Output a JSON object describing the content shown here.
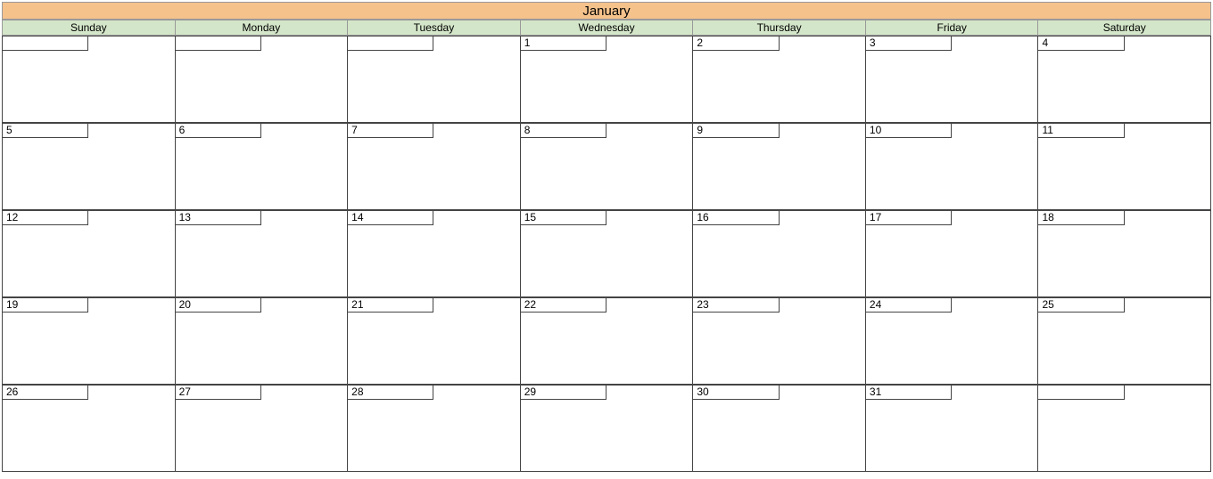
{
  "month": "January",
  "day_names": [
    "Sunday",
    "Monday",
    "Tuesday",
    "Wednesday",
    "Thursday",
    "Friday",
    "Saturday"
  ],
  "weeks": [
    [
      "",
      "",
      "",
      "1",
      "2",
      "3",
      "4"
    ],
    [
      "5",
      "6",
      "7",
      "8",
      "9",
      "10",
      "11"
    ],
    [
      "12",
      "13",
      "14",
      "15",
      "16",
      "17",
      "18"
    ],
    [
      "19",
      "20",
      "21",
      "22",
      "23",
      "24",
      "25"
    ],
    [
      "26",
      "27",
      "28",
      "29",
      "30",
      "31",
      ""
    ]
  ],
  "colors": {
    "month_bg": "#f5c28c",
    "day_header_bg": "#d4e6c9"
  }
}
